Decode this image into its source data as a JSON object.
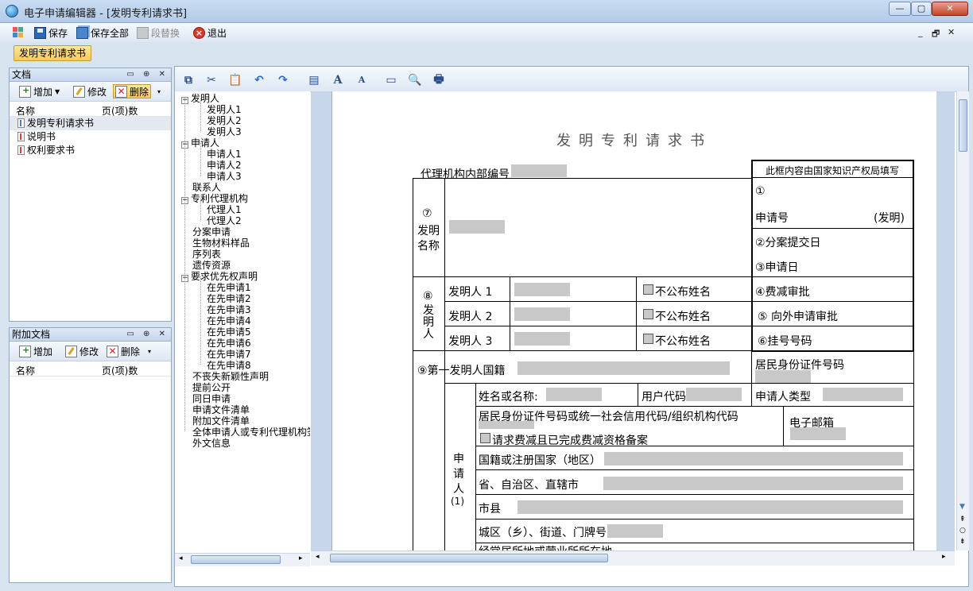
{
  "window": {
    "title": "电子申请编辑器 - [发明专利请求书]"
  },
  "toolbar": {
    "save": "保存",
    "save_all": "保存全部",
    "para_replace": "段替换",
    "exit": "退出"
  },
  "mdi": {
    "min": "_",
    "restore": "🗗",
    "close": "✕"
  },
  "doc_tab": "发明专利请求书",
  "docs_panel": {
    "title": "文档",
    "add": "增加",
    "edit": "修改",
    "delete": "删除",
    "col_name": "名称",
    "col_pages": "页(项)数",
    "items": [
      "发明专利请求书",
      "说明书",
      "权利要求书"
    ]
  },
  "attach_panel": {
    "title": "附加文档",
    "add": "增加",
    "edit": "修改",
    "delete": "删除",
    "col_name": "名称",
    "col_pages": "页(项)数"
  },
  "tree": {
    "inventor": "发明人",
    "inventor1": "发明人1",
    "inventor2": "发明人2",
    "inventor3": "发明人3",
    "applicant": "申请人",
    "applicant1": "申请人1",
    "applicant2": "申请人2",
    "applicant3": "申请人3",
    "contact": "联系人",
    "agency": "专利代理机构",
    "agent1": "代理人1",
    "agent2": "代理人2",
    "divisional": "分案申请",
    "bio": "生物材料样品",
    "sequence": "序列表",
    "genetic": "遗传资源",
    "priority": "要求优先权声明",
    "prior1": "在先申请1",
    "prior2": "在先申请2",
    "prior3": "在先申请3",
    "prior4": "在先申请4",
    "prior5": "在先申请5",
    "prior6": "在先申请6",
    "prior7": "在先申请7",
    "prior8": "在先申请8",
    "novelty": "不丧失新颖性声明",
    "early": "提前公开",
    "same_day": "同日申请",
    "file_list": "申请文件清单",
    "attach_list": "附加文件清单",
    "all_sign": "全体申请人或专利代理机构签",
    "foreign": "外文信息"
  },
  "form": {
    "title": "发明专利请求书",
    "agency_no": "代理机构内部编号",
    "office_box": "此框内容由国家知识产权局填写",
    "c1": "①",
    "app_no": "申请号",
    "app_no_type": "(发明)",
    "c2": "②分案提交日",
    "c3": "③申请日",
    "c4": "④费减审批",
    "c5": "⑤ 向外申请审批",
    "c6": "⑥挂号号码",
    "invention_name": [
      "⑦",
      "发明",
      "名称"
    ],
    "inventor_label": [
      "⑧",
      "发",
      "明",
      "人"
    ],
    "inventor1": "发明人 1",
    "inventor2": "发明人 2",
    "inventor3": "发明人 3",
    "no_publish": "不公布姓名",
    "first_nationality": "⑨第一发明人国籍",
    "id_no": "居民身份证件号码",
    "applicant_label": [
      "申",
      "请",
      "人",
      "(1)"
    ],
    "name": "姓名或名称:",
    "user_code": "用户代码",
    "app_type": "申请人类型",
    "id_code": "居民身份证件号码或统一社会信用代码/组织机构代码",
    "email": "电子邮箱",
    "fee_reduce": "请求费减且已完成费减资格备案",
    "country": "国籍或注册国家（地区）",
    "province": "省、自治区、直辖市",
    "city": "市县",
    "district": "城区（乡）、街道、门牌号",
    "residence": "经常居所地或营业所所在地"
  }
}
